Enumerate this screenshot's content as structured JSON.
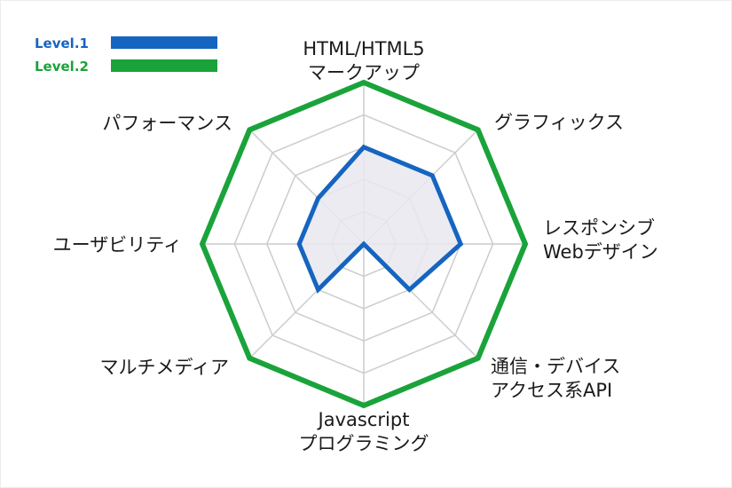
{
  "chart_data": {
    "type": "radar",
    "categories": [
      [
        "HTML/HTML5",
        "マークアップ"
      ],
      [
        "グラフィックス"
      ],
      [
        "レスポンシブ",
        "Webデザイン"
      ],
      [
        "通信・デバイス",
        "アクセス系API"
      ],
      [
        "Javascript",
        "プログラミング"
      ],
      [
        "マルチメディア"
      ],
      [
        "ユーザビリティ"
      ],
      [
        "パフォーマンス"
      ]
    ],
    "rmax": 5,
    "grid_levels": 5,
    "series": [
      {
        "name": "Level.1",
        "color": "#1565c0",
        "fill": "#e8e8ee",
        "values": [
          3,
          3,
          3,
          2,
          0,
          2,
          2,
          2
        ]
      },
      {
        "name": "Level.2",
        "color": "#1aa33a",
        "fill": "none",
        "values": [
          5,
          5,
          5,
          5,
          5,
          5,
          5,
          5
        ]
      }
    ],
    "legend_position": "top-left",
    "grid": true
  }
}
